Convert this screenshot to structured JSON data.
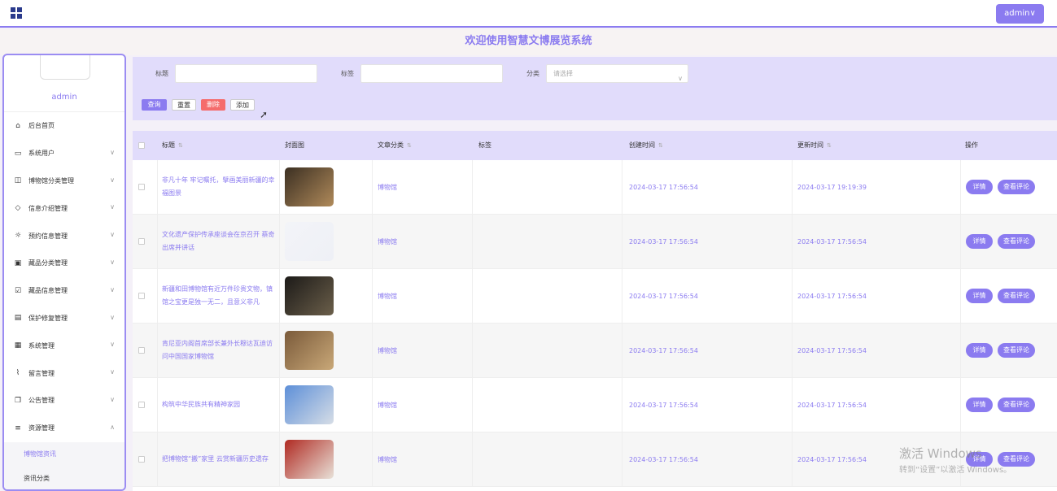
{
  "header": {
    "admin_label": "admin∨",
    "welcome": "欢迎使用智慧文博展览系统"
  },
  "sidebar": {
    "username": "admin",
    "items": [
      {
        "label": "后台首页",
        "icon": "home-icon",
        "has_chevron": false
      },
      {
        "label": "系统用户",
        "icon": "monitor-icon",
        "has_chevron": true
      },
      {
        "label": "博物馆分类管理",
        "icon": "bookmark-icon",
        "has_chevron": true
      },
      {
        "label": "信息介绍管理",
        "icon": "tag-icon",
        "has_chevron": true
      },
      {
        "label": "预约信息管理",
        "icon": "sun-icon",
        "has_chevron": true
      },
      {
        "label": "藏品分类管理",
        "icon": "inbox-icon",
        "has_chevron": true
      },
      {
        "label": "藏品信息管理",
        "icon": "clipboard-icon",
        "has_chevron": true
      },
      {
        "label": "保护修复管理",
        "icon": "message-icon",
        "has_chevron": true
      },
      {
        "label": "系统管理",
        "icon": "calendar-icon",
        "has_chevron": true
      },
      {
        "label": "留言管理",
        "icon": "paperclip-icon",
        "has_chevron": true
      },
      {
        "label": "公告管理",
        "icon": "copy-icon",
        "has_chevron": true
      },
      {
        "label": "资源管理",
        "icon": "sliders-icon",
        "has_chevron": true
      }
    ],
    "subitems": [
      "博物馆资讯",
      "资讯分类"
    ]
  },
  "search": {
    "title_label": "标题",
    "tag_label": "标签",
    "category_label": "分类",
    "category_placeholder": "请选择",
    "buttons": {
      "query": "查询",
      "reset": "重置",
      "delete": "删除",
      "add": "添加"
    }
  },
  "table": {
    "headers": [
      "标题",
      "封面图",
      "文章分类",
      "标签",
      "创建时间",
      "更新时间",
      "操作"
    ],
    "rows": [
      {
        "title": "非凡十年 牢记嘱托，擘画美丽新疆的幸福图景",
        "category": "博物馆",
        "tag": "",
        "created": "2024-03-17 17:56:54",
        "updated": "2024-03-17 19:19:39",
        "thumb": [
          "#3b2f22",
          "#b08a5a"
        ]
      },
      {
        "title": "文化遗产保护传承座谈会在京召开 蔡奇出席并讲话",
        "category": "博物馆",
        "tag": "",
        "created": "2024-03-17 17:56:54",
        "updated": "2024-03-17 17:56:54",
        "thumb": [
          "#f3f4f8",
          "#eef0f6"
        ]
      },
      {
        "title": "新疆和田博物馆有近万件珍贵文物，镇馆之宝更是独一无二，且意义非凡",
        "category": "博物馆",
        "tag": "",
        "created": "2024-03-17 17:56:54",
        "updated": "2024-03-17 17:56:54",
        "thumb": [
          "#1c1a18",
          "#6b5f4a"
        ]
      },
      {
        "title": "肯尼亚内阁首席部长兼外长穆达瓦迪访问中国国家博物馆",
        "category": "博物馆",
        "tag": "",
        "created": "2024-03-17 17:56:54",
        "updated": "2024-03-17 17:56:54",
        "thumb": [
          "#7a5a3a",
          "#c9a878"
        ]
      },
      {
        "title": "构筑中华民族共有精神家园",
        "category": "博物馆",
        "tag": "",
        "created": "2024-03-17 17:56:54",
        "updated": "2024-03-17 17:56:54",
        "thumb": [
          "#5d8fd8",
          "#d6dde6"
        ]
      },
      {
        "title": "把博物馆“搬”家里 云赏新疆历史遗存",
        "category": "博物馆",
        "tag": "",
        "created": "2024-03-17 17:56:54",
        "updated": "2024-03-17 17:56:54",
        "thumb": [
          "#b02a22",
          "#e8e1d8"
        ]
      }
    ],
    "op_detail": "详情",
    "op_comment": "查看评论"
  },
  "watermark": {
    "line1": "激活 Windows",
    "line2": "转到“设置”以激活 Windows。"
  }
}
